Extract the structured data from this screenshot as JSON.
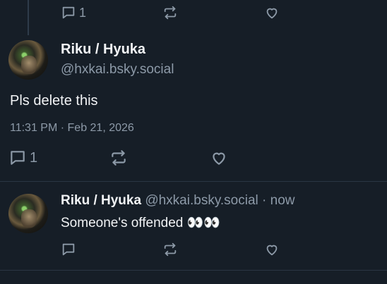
{
  "top_actions": {
    "reply_count": "1"
  },
  "main_post": {
    "author_name": "Riku / Hyuka",
    "author_handle": "@hxkai.bsky.social",
    "text": "Pls delete this",
    "timestamp": "11:31 PM · Feb 21, 2026",
    "reply_count": "1"
  },
  "reply_post": {
    "author_name": "Riku / Hyuka",
    "author_handle": "@hxkai.bsky.social",
    "separator": "·",
    "time": "now",
    "text": "Someone's offended 👀👀"
  },
  "icons": [
    "reply-icon",
    "repost-icon",
    "like-icon"
  ],
  "colors": {
    "background": "#161e27",
    "muted": "#8d9aa8",
    "text": "#f1f3f5",
    "divider": "#2a3644"
  }
}
